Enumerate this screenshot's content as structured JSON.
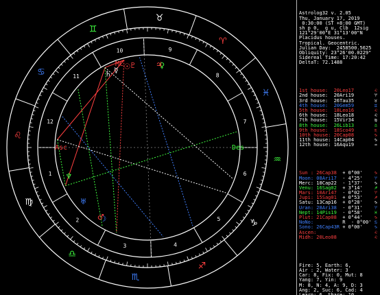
{
  "header_lines": [
    "Astrolog32 v. 2.05",
    "Thu, January 17, 2019",
    " 0:30:00 (ST +8:00 GMT)",
    "sh p 0,  g u, Clb  12sig",
    "121°29'00\"E 31°13'00\"N",
    "Placidus houses.",
    "Tropical. Geocentric.",
    "Julian Day:  2458500.5625",
    "Obliquity: 23°26'00.0229\"",
    "Sidereal Time: 17:20:42",
    "DeltaT: 72.1488"
  ],
  "houses": [
    {
      "label": "1st house:",
      "value": "20Leo17",
      "color": "#ff4040",
      "glyph": "♌"
    },
    {
      "label": "2nd house:",
      "value": "20Ari19",
      "color": "#ffffff",
      "glyph": "♈"
    },
    {
      "label": "3rd house:",
      "value": "26Tau35",
      "color": "#ffffff",
      "glyph": "♉"
    },
    {
      "label": "4th house:",
      "value": "20Gem59",
      "color": "#4080ff",
      "glyph": "♊"
    },
    {
      "label": "5th house:",
      "value": "18Leo16",
      "color": "#ff4040",
      "glyph": "♌"
    },
    {
      "label": "6th house:",
      "value": "18Leo18",
      "color": "#ffffff",
      "glyph": "♌"
    },
    {
      "label": "7th house:",
      "value": "15Vir34",
      "color": "#ffffff",
      "glyph": "♍"
    },
    {
      "label": "8th house:",
      "value": "26Lib13",
      "color": "#40ff40",
      "glyph": "♎"
    },
    {
      "label": "9th house:",
      "value": "18Sco49",
      "color": "#ff4040",
      "glyph": "♏"
    },
    {
      "label": "10th house:",
      "value": "20Cap08",
      "color": "#ff4040",
      "glyph": "♑"
    },
    {
      "label": "11th house:",
      "value": "14Cap04",
      "color": "#ffffff",
      "glyph": "♑"
    },
    {
      "label": "12th house:",
      "value": "16Aqu19",
      "color": "#ffffff",
      "glyph": "♒"
    }
  ],
  "planets": [
    {
      "name": "Sun :",
      "pos": "26Cap38",
      "lat": "+ 0°00'",
      "color": "#ff4040",
      "glyph": "♑"
    },
    {
      "name": "Moon:",
      "pos": "08Ari17",
      "lat": "- 4°25'",
      "color": "#4080ff",
      "glyph": "♈"
    },
    {
      "name": "Merc:",
      "pos": "18Cap22",
      "lat": "- 1°37'",
      "color": "#ffffff",
      "glyph": "♑"
    },
    {
      "name": "Venu:",
      "pos": "16Sag02",
      "lat": "+ 3°14'",
      "color": "#40ff40",
      "glyph": "♐"
    },
    {
      "name": "Mars:",
      "pos": "10Ari47",
      "lat": "- 0°02'",
      "color": "#ff4040",
      "glyph": "♈"
    },
    {
      "name": "Jupi:",
      "pos": "15Sag01",
      "lat": "+ 0°53'",
      "color": "#ff4040",
      "glyph": "♐"
    },
    {
      "name": "Satu:",
      "pos": "13Cap16",
      "lat": "+ 0°28'",
      "color": "#ffffff",
      "glyph": "♑"
    },
    {
      "name": "Uran:",
      "pos": "28Ari38",
      "lat": "- 0°31'",
      "color": "#4080ff",
      "glyph": "♈"
    },
    {
      "name": "Nept:",
      "pos": "14Pis19",
      "lat": "- 0°58'",
      "color": "#40ff40",
      "glyph": "♓"
    },
    {
      "name": "Plut:",
      "pos": "21Cap08",
      "lat": "+ 0°44'",
      "color": "#ff4040",
      "glyph": "♑"
    },
    {
      "name": "NoNo:",
      "pos": "",
      "lat": "R  - 0°00'",
      "color": "#4080ff",
      "glyph": "♋"
    },
    {
      "name": "Sono:",
      "pos": "26Cap43R",
      "lat": "+ 0°00'",
      "color": "#4080ff",
      "glyph": "♑"
    },
    {
      "name": "Ascen:",
      "pos": "",
      "lat": "",
      "color": "#ff4040",
      "glyph": "♌"
    },
    {
      "name": "Midh:",
      "pos": "20Leo08",
      "lat": "",
      "color": "#ff4040",
      "glyph": "♌"
    }
  ],
  "stats": [
    "Fire: 5, Earth: 6,",
    "Air : 2, Water: 3",
    "Car: 8, Fix: 0, Mut: 8",
    "Yang: 7, Yin: 9",
    "M: 8, N: 4, A: 9, D: 3",
    "Ang: 2, Suc: 6, Cad: 4",
    "Learn: 6, Share: 10"
  ],
  "chart_labels": {
    "asc": "Asc",
    "des": "Des",
    "mc": "MC",
    "ic": "IC"
  },
  "house_numbers": [
    "1",
    "2",
    "3",
    "4",
    "5",
    "6",
    "7",
    "8",
    "9",
    "10",
    "11",
    "12"
  ],
  "zodiac_glyphs": [
    "♈",
    "♉",
    "♊",
    "♋",
    "♌",
    "♍",
    "♎",
    "♏",
    "♐",
    "♑",
    "♒",
    "♓"
  ],
  "colors": {
    "fire": "#ff4040",
    "earth": "#ffffff",
    "air": "#40ff40",
    "water": "#4080ff",
    "ring": "#ffffff",
    "panel_border": "#bbbbbb"
  }
}
